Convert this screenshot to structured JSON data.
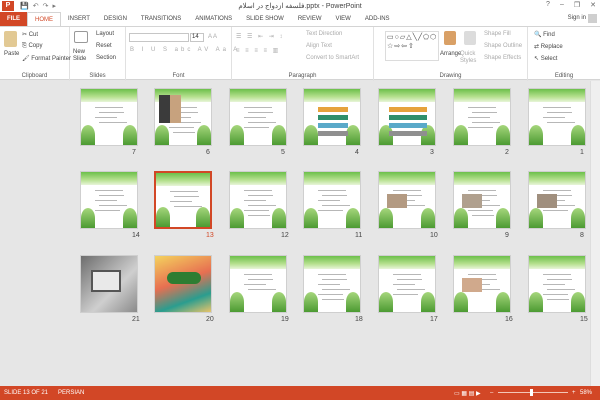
{
  "window": {
    "app_icon": "P",
    "title": "فلسفه ازدواج در اسلام.pptx - PowerPoint",
    "help": "?",
    "minimize": "–",
    "restore": "❐",
    "close": "✕",
    "qat": [
      "💾",
      "↶",
      "↷",
      "▸"
    ]
  },
  "tabs": [
    "FILE",
    "HOME",
    "INSERT",
    "DESIGN",
    "TRANSITIONS",
    "ANIMATIONS",
    "SLIDE SHOW",
    "REVIEW",
    "VIEW",
    "ADD-INS"
  ],
  "account": {
    "signin": "Sign in"
  },
  "ribbon": {
    "clipboard": {
      "label": "Clipboard",
      "paste": "Paste",
      "cut": "Cut",
      "copy": "Copy",
      "painter": "Format Painter"
    },
    "slides": {
      "label": "Slides",
      "new_slide": "New Slide",
      "layout": "Layout",
      "reset": "Reset",
      "section": "Section"
    },
    "font": {
      "label": "Font",
      "size": "14"
    },
    "paragraph": {
      "label": "Paragraph",
      "text_direction": "Text Direction",
      "align_text": "Align Text",
      "smartart": "Convert to SmartArt"
    },
    "drawing": {
      "label": "Drawing",
      "arrange": "Arrange",
      "quick_styles": "Quick Styles",
      "shape_fill": "Shape Fill",
      "shape_outline": "Shape Outline",
      "shape_effects": "Shape Effects",
      "shapes": "▭○▱△╲╱⬠⬡↺{}☆⇨⇦⇧"
    },
    "editing": {
      "label": "Editing",
      "find": "Find",
      "replace": "Replace",
      "select": "Select"
    }
  },
  "slides": [
    {
      "n": "1"
    },
    {
      "n": "2"
    },
    {
      "n": "3"
    },
    {
      "n": "4"
    },
    {
      "n": "5"
    },
    {
      "n": "6"
    },
    {
      "n": "7"
    },
    {
      "n": "8"
    },
    {
      "n": "9"
    },
    {
      "n": "10"
    },
    {
      "n": "11"
    },
    {
      "n": "12"
    },
    {
      "n": "13"
    },
    {
      "n": "14"
    },
    {
      "n": "15"
    },
    {
      "n": "16"
    },
    {
      "n": "17"
    },
    {
      "n": "18"
    },
    {
      "n": "19"
    },
    {
      "n": "20"
    },
    {
      "n": "21"
    }
  ],
  "selected_slide": "13",
  "status": {
    "slide": "SLIDE 13 OF 21",
    "language": "PERSIAN",
    "zoom": "58%"
  },
  "colors": {
    "accent": "#d24726",
    "leaf": "#6cc04a"
  }
}
